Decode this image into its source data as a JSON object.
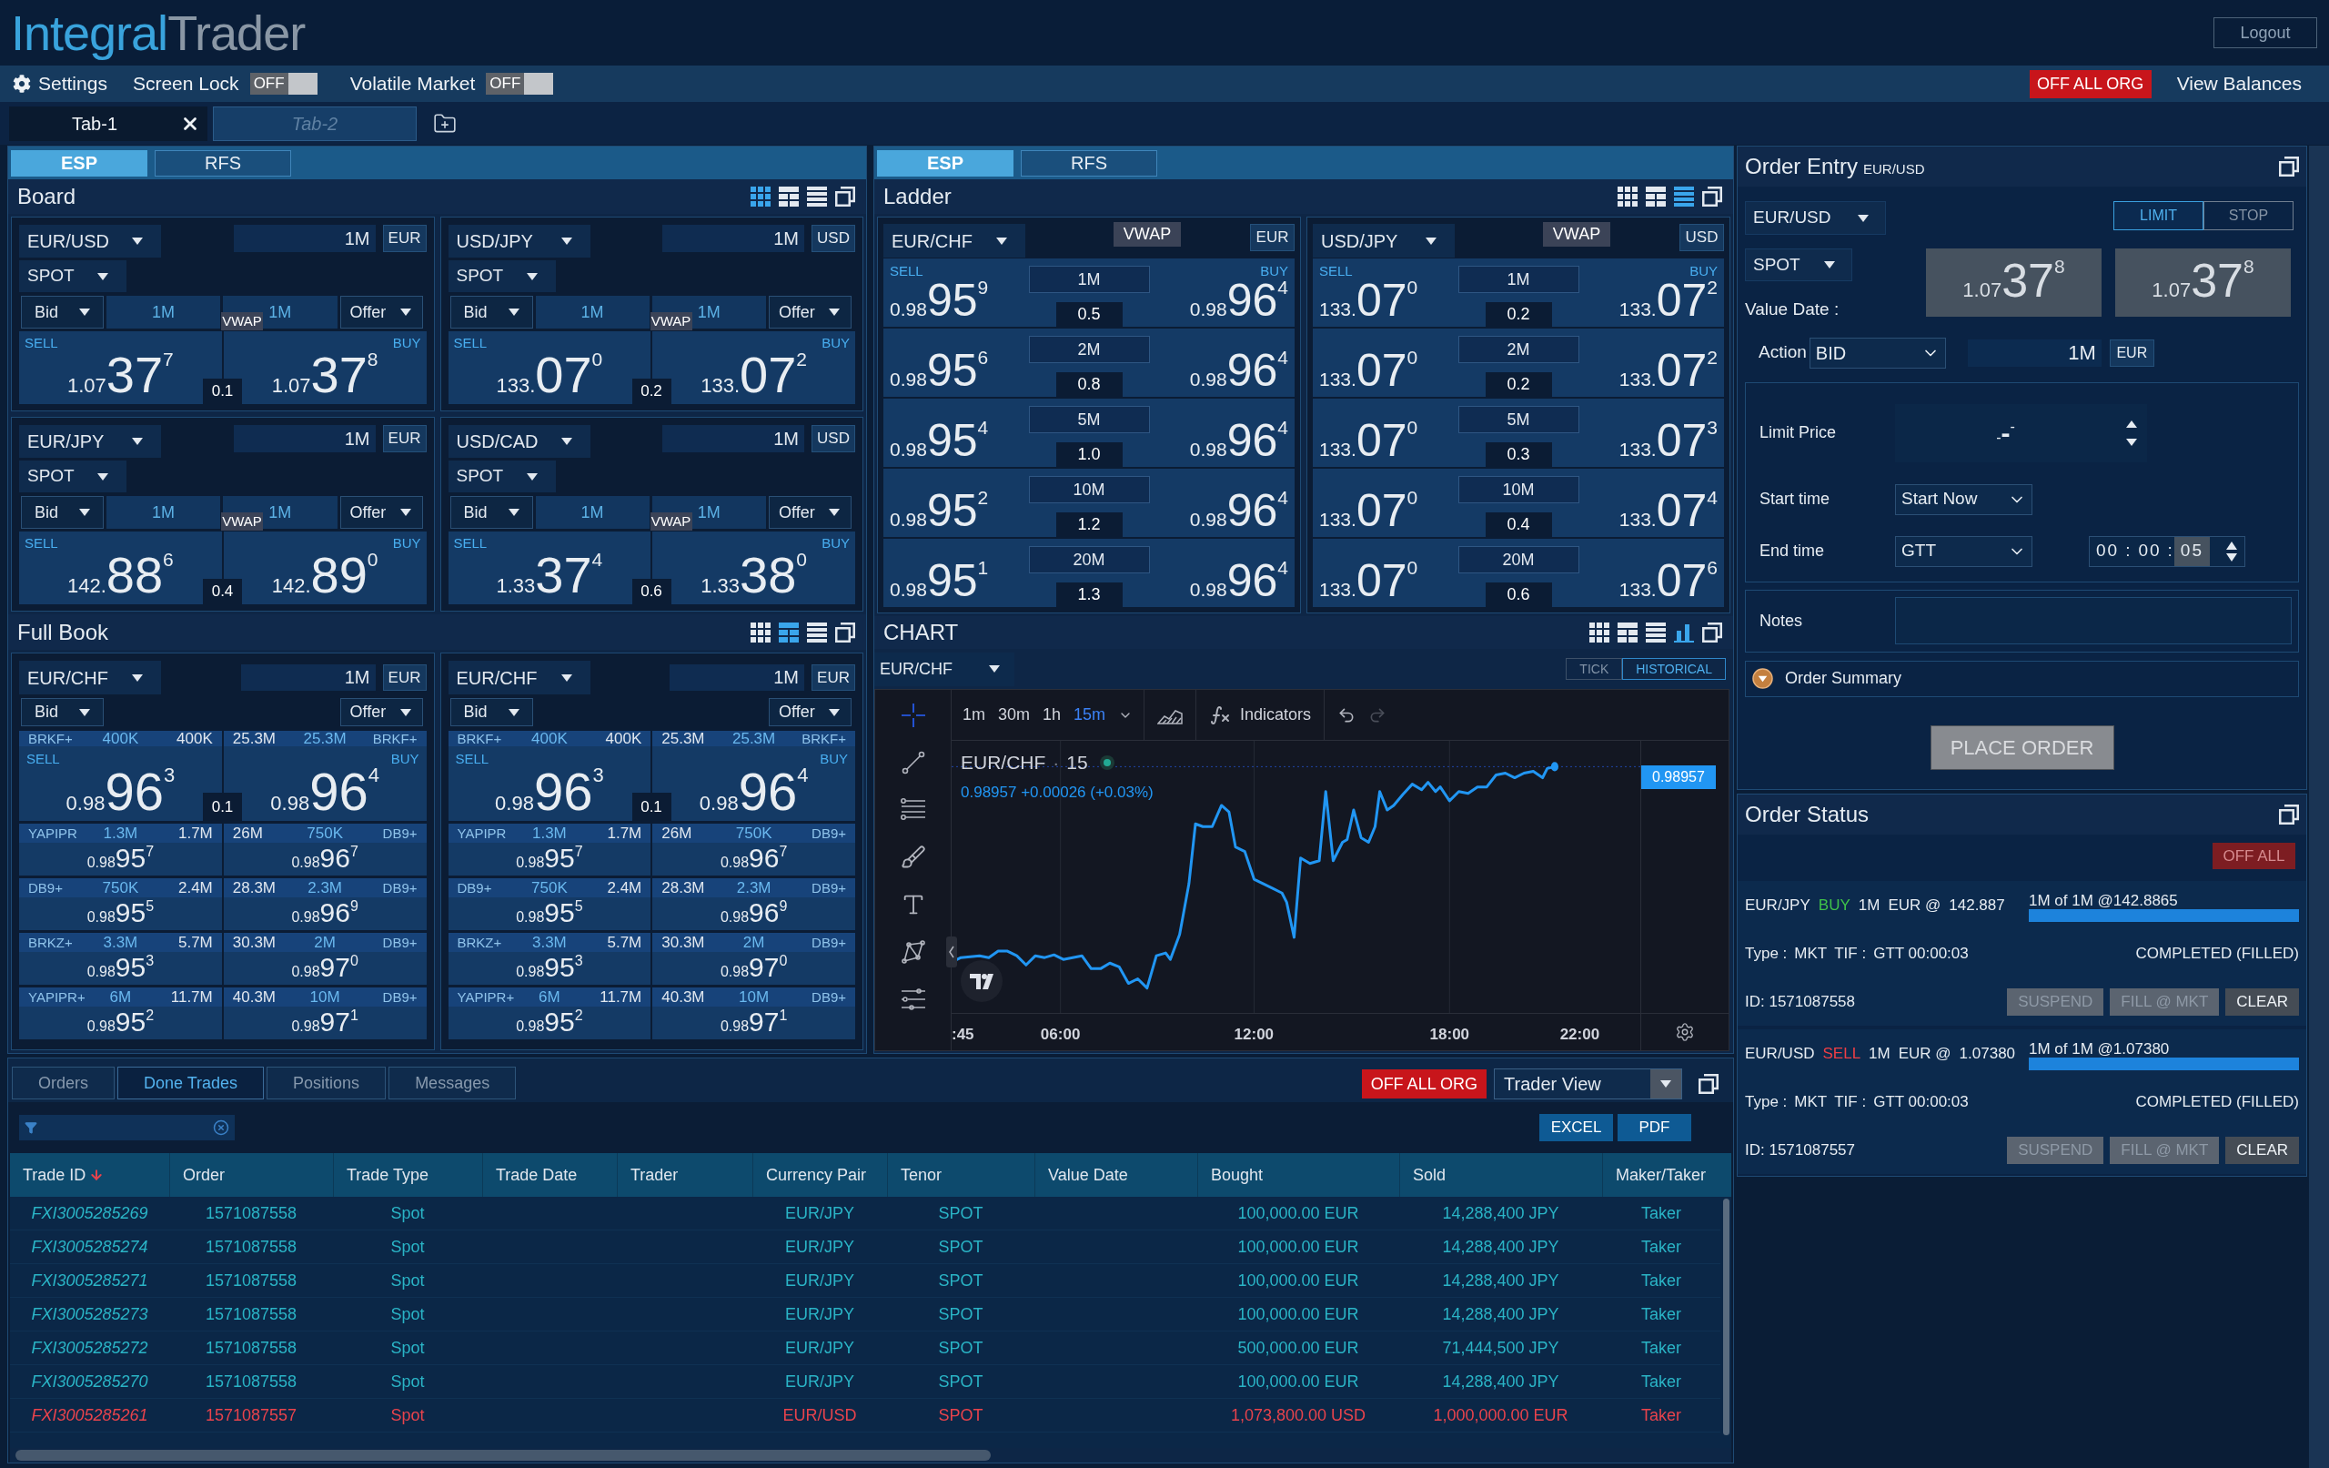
{
  "header": {
    "logo": {
      "first_part": "Integral",
      "second_part": "Trader"
    },
    "logout_button": "Logout"
  },
  "toolbar": {
    "settings": "Settings",
    "switches": [
      {
        "label": "Screen Lock",
        "state_text": "OFF",
        "on": false
      },
      {
        "label": "Volatile Market",
        "state_text": "OFF",
        "on": false
      }
    ],
    "off_all_org_button": "OFF ALL ORG",
    "view_balances": "View Balances"
  },
  "workspace_tabs": [
    {
      "label": "Tab-1",
      "selected": true
    },
    {
      "label": "Tab-2",
      "selected": false
    }
  ],
  "left_column": {
    "mode_tabs": [
      {
        "label": "ESP",
        "selected": true
      },
      {
        "label": "RFS",
        "selected": false
      }
    ],
    "board": {
      "title": "Board",
      "views": [
        {
          "kind": "grid",
          "selected": true
        },
        {
          "kind": "tiles",
          "selected": false
        },
        {
          "kind": "list",
          "selected": false
        }
      ],
      "tiles": [
        {
          "pair": "EUR/USD",
          "tenor": "SPOT",
          "amount": "1M",
          "currency": "EUR",
          "bid_select": "Bid",
          "bid_amount": "1M",
          "vwap": "VWAP",
          "offer_amount": "1M",
          "offer_select": "Offer",
          "sell_label": "SELL",
          "buy_label": "BUY",
          "sell_price": {
            "big": "1.07",
            "pips": "37",
            "frac": "7"
          },
          "buy_price": {
            "big": "1.07",
            "pips": "37",
            "frac": "8"
          },
          "spread": "0.1"
        },
        {
          "pair": "USD/JPY",
          "tenor": "SPOT",
          "amount": "1M",
          "currency": "USD",
          "bid_select": "Bid",
          "bid_amount": "1M",
          "vwap": "VWAP",
          "offer_amount": "1M",
          "offer_select": "Offer",
          "sell_label": "SELL",
          "buy_label": "BUY",
          "sell_price": {
            "big": "133.",
            "pips": "07",
            "frac": "0"
          },
          "buy_price": {
            "big": "133.",
            "pips": "07",
            "frac": "2"
          },
          "spread": "0.2"
        },
        {
          "pair": "EUR/JPY",
          "tenor": "SPOT",
          "amount": "1M",
          "currency": "EUR",
          "bid_select": "Bid",
          "bid_amount": "1M",
          "vwap": "VWAP",
          "offer_amount": "1M",
          "offer_select": "Offer",
          "sell_label": "SELL",
          "buy_label": "BUY",
          "sell_price": {
            "big": "142.",
            "pips": "88",
            "frac": "6"
          },
          "buy_price": {
            "big": "142.",
            "pips": "89",
            "frac": "0"
          },
          "spread": "0.4"
        },
        {
          "pair": "USD/CAD",
          "tenor": "SPOT",
          "amount": "1M",
          "currency": "USD",
          "bid_select": "Bid",
          "bid_amount": "1M",
          "vwap": "VWAP",
          "offer_amount": "1M",
          "offer_select": "Offer",
          "sell_label": "SELL",
          "buy_label": "BUY",
          "sell_price": {
            "big": "1.33",
            "pips": "37",
            "frac": "4"
          },
          "buy_price": {
            "big": "1.33",
            "pips": "38",
            "frac": "0"
          },
          "spread": "0.6"
        }
      ]
    },
    "full_book": {
      "title": "Full Book",
      "views": [
        {
          "kind": "grid",
          "selected": false
        },
        {
          "kind": "tiles",
          "selected": true
        },
        {
          "kind": "list",
          "selected": false
        }
      ],
      "books": [
        {
          "pair": "EUR/CHF",
          "amount": "1M",
          "currency": "EUR",
          "bid_select": "Bid",
          "offer_select": "Offer",
          "sell_label": "SELL",
          "buy_label": "BUY",
          "spread": "0.1",
          "levels": [
            {
              "bid": {
                "provider": "BRKF+",
                "size": "400K",
                "total": "400K",
                "price": {
                  "big": "0.98",
                  "pips": "96",
                  "frac": "3"
                }
              },
              "offer": {
                "total": "25.3M",
                "size": "25.3M",
                "provider": "BRKF+",
                "price": {
                  "big": "0.98",
                  "pips": "96",
                  "frac": "4"
                }
              }
            },
            {
              "bid": {
                "provider": "YAPIPR",
                "size": "1.3M",
                "total": "1.7M",
                "price": {
                  "big": "0.98",
                  "pips": "95",
                  "frac": "7"
                }
              },
              "offer": {
                "total": "26M",
                "size": "750K",
                "provider": "DB9+",
                "price": {
                  "big": "0.98",
                  "pips": "96",
                  "frac": "7"
                }
              }
            },
            {
              "bid": {
                "provider": "DB9+",
                "size": "750K",
                "total": "2.4M",
                "price": {
                  "big": "0.98",
                  "pips": "95",
                  "frac": "5"
                }
              },
              "offer": {
                "total": "28.3M",
                "size": "2.3M",
                "provider": "DB9+",
                "price": {
                  "big": "0.98",
                  "pips": "96",
                  "frac": "9"
                }
              }
            },
            {
              "bid": {
                "provider": "BRKZ+",
                "size": "3.3M",
                "total": "5.7M",
                "price": {
                  "big": "0.98",
                  "pips": "95",
                  "frac": "3"
                }
              },
              "offer": {
                "total": "30.3M",
                "size": "2M",
                "provider": "DB9+",
                "price": {
                  "big": "0.98",
                  "pips": "97",
                  "frac": "0"
                }
              }
            },
            {
              "bid": {
                "provider": "YAPIPR+",
                "size": "6M",
                "total": "11.7M",
                "price": {
                  "big": "0.98",
                  "pips": "95",
                  "frac": "2"
                }
              },
              "offer": {
                "total": "40.3M",
                "size": "10M",
                "provider": "DB9+",
                "price": {
                  "big": "0.98",
                  "pips": "97",
                  "frac": "1"
                }
              }
            }
          ]
        },
        {
          "pair": "EUR/CHF",
          "amount": "1M",
          "currency": "EUR",
          "bid_select": "Bid",
          "offer_select": "Offer",
          "sell_label": "SELL",
          "buy_label": "BUY",
          "spread": "0.1",
          "levels": [
            {
              "bid": {
                "provider": "BRKF+",
                "size": "400K",
                "total": "400K",
                "price": {
                  "big": "0.98",
                  "pips": "96",
                  "frac": "3"
                }
              },
              "offer": {
                "total": "25.3M",
                "size": "25.3M",
                "provider": "BRKF+",
                "price": {
                  "big": "0.98",
                  "pips": "96",
                  "frac": "4"
                }
              }
            },
            {
              "bid": {
                "provider": "YAPIPR",
                "size": "1.3M",
                "total": "1.7M",
                "price": {
                  "big": "0.98",
                  "pips": "95",
                  "frac": "7"
                }
              },
              "offer": {
                "total": "26M",
                "size": "750K",
                "provider": "DB9+",
                "price": {
                  "big": "0.98",
                  "pips": "96",
                  "frac": "7"
                }
              }
            },
            {
              "bid": {
                "provider": "DB9+",
                "size": "750K",
                "total": "2.4M",
                "price": {
                  "big": "0.98",
                  "pips": "95",
                  "frac": "5"
                }
              },
              "offer": {
                "total": "28.3M",
                "size": "2.3M",
                "provider": "DB9+",
                "price": {
                  "big": "0.98",
                  "pips": "96",
                  "frac": "9"
                }
              }
            },
            {
              "bid": {
                "provider": "BRKZ+",
                "size": "3.3M",
                "total": "5.7M",
                "price": {
                  "big": "0.98",
                  "pips": "95",
                  "frac": "3"
                }
              },
              "offer": {
                "total": "30.3M",
                "size": "2M",
                "provider": "DB9+",
                "price": {
                  "big": "0.98",
                  "pips": "97",
                  "frac": "0"
                }
              }
            },
            {
              "bid": {
                "provider": "YAPIPR+",
                "size": "6M",
                "total": "11.7M",
                "price": {
                  "big": "0.98",
                  "pips": "95",
                  "frac": "2"
                }
              },
              "offer": {
                "total": "40.3M",
                "size": "10M",
                "provider": "DB9+",
                "price": {
                  "big": "0.98",
                  "pips": "97",
                  "frac": "1"
                }
              }
            }
          ]
        }
      ]
    }
  },
  "middle_column": {
    "mode_tabs": [
      {
        "label": "ESP",
        "selected": true
      },
      {
        "label": "RFS",
        "selected": false
      }
    ],
    "ladder": {
      "title": "Ladder",
      "views": [
        {
          "kind": "grid",
          "selected": false
        },
        {
          "kind": "tiles",
          "selected": false
        },
        {
          "kind": "list",
          "selected": true
        }
      ],
      "books": [
        {
          "pair": "EUR/CHF",
          "vwap": "VWAP",
          "currency": "EUR",
          "sell_label": "SELL",
          "buy_label": "BUY",
          "rows": [
            {
              "size": "1M",
              "spread": "0.5",
              "sell_price": {
                "big": "0.98",
                "pips": "95",
                "frac": "9"
              },
              "buy_price": {
                "big": "0.98",
                "pips": "96",
                "frac": "4"
              }
            },
            {
              "size": "2M",
              "spread": "0.8",
              "sell_price": {
                "big": "0.98",
                "pips": "95",
                "frac": "6"
              },
              "buy_price": {
                "big": "0.98",
                "pips": "96",
                "frac": "4"
              }
            },
            {
              "size": "5M",
              "spread": "1.0",
              "sell_price": {
                "big": "0.98",
                "pips": "95",
                "frac": "4"
              },
              "buy_price": {
                "big": "0.98",
                "pips": "96",
                "frac": "4"
              }
            },
            {
              "size": "10M",
              "spread": "1.2",
              "sell_price": {
                "big": "0.98",
                "pips": "95",
                "frac": "2"
              },
              "buy_price": {
                "big": "0.98",
                "pips": "96",
                "frac": "4"
              }
            },
            {
              "size": "20M",
              "spread": "1.3",
              "sell_price": {
                "big": "0.98",
                "pips": "95",
                "frac": "1"
              },
              "buy_price": {
                "big": "0.98",
                "pips": "96",
                "frac": "4"
              }
            }
          ]
        },
        {
          "pair": "USD/JPY",
          "vwap": "VWAP",
          "currency": "USD",
          "sell_label": "SELL",
          "buy_label": "BUY",
          "rows": [
            {
              "size": "1M",
              "spread": "0.2",
              "sell_price": {
                "big": "133.",
                "pips": "07",
                "frac": "0"
              },
              "buy_price": {
                "big": "133.",
                "pips": "07",
                "frac": "2"
              }
            },
            {
              "size": "2M",
              "spread": "0.2",
              "sell_price": {
                "big": "133.",
                "pips": "07",
                "frac": "0"
              },
              "buy_price": {
                "big": "133.",
                "pips": "07",
                "frac": "2"
              }
            },
            {
              "size": "5M",
              "spread": "0.3",
              "sell_price": {
                "big": "133.",
                "pips": "07",
                "frac": "0"
              },
              "buy_price": {
                "big": "133.",
                "pips": "07",
                "frac": "3"
              }
            },
            {
              "size": "10M",
              "spread": "0.4",
              "sell_price": {
                "big": "133.",
                "pips": "07",
                "frac": "0"
              },
              "buy_price": {
                "big": "133.",
                "pips": "07",
                "frac": "4"
              }
            },
            {
              "size": "20M",
              "spread": "0.6",
              "sell_price": {
                "big": "133.",
                "pips": "07",
                "frac": "0"
              },
              "buy_price": {
                "big": "133.",
                "pips": "07",
                "frac": "6"
              }
            }
          ]
        }
      ]
    },
    "chart": {
      "title": "CHART",
      "views": [
        {
          "kind": "grid",
          "selected": false
        },
        {
          "kind": "tiles",
          "selected": false
        },
        {
          "kind": "list",
          "selected": false
        },
        {
          "kind": "bars",
          "selected": true
        }
      ],
      "pair": "EUR/CHF",
      "source_tabs": [
        {
          "label": "TICK",
          "selected": false
        },
        {
          "label": "HISTORICAL",
          "selected": true
        }
      ],
      "intervals": [
        {
          "label": "1m",
          "selected": false
        },
        {
          "label": "30m",
          "selected": false
        },
        {
          "label": "1h",
          "selected": false
        },
        {
          "label": "15m",
          "selected": true
        }
      ],
      "indicators_button": "Indicators",
      "legend": {
        "symbol": "EUR/CHF",
        "separator": "·",
        "interval": "15",
        "quote": "0.98957 +0.00026 (+0.03%)"
      },
      "last_price": "0.98957",
      "time_labels": [
        ":45",
        "06:00",
        "12:00",
        "18:00",
        "22:00"
      ]
    }
  },
  "right_column": {
    "order_entry": {
      "title": "Order Entry",
      "pair_caption": "EUR/USD",
      "pair": "EUR/USD",
      "order_types": [
        {
          "label": "LIMIT",
          "selected": true
        },
        {
          "label": "STOP",
          "selected": false
        }
      ],
      "tenor": "SPOT",
      "value_date_label": "Value Date :",
      "bid_price": {
        "big": "1.07",
        "pips": "37",
        "frac": "8"
      },
      "offer_price": {
        "big": "1.07",
        "pips": "37",
        "frac": "8"
      },
      "action_label": "Action",
      "action": "BID",
      "amount": "1M",
      "currency": "EUR",
      "limit_price_label": "Limit Price",
      "limit_price": {
        "big": "-",
        "pips": "-",
        "frac": "-"
      },
      "start_time_label": "Start time",
      "start_time": "Start Now",
      "end_time_label": "End time",
      "end_time": "GTT",
      "expiry": {
        "segments": [
          {
            "text": "00",
            "selected": false
          },
          {
            "text": "00",
            "selected": false
          },
          {
            "text": "05",
            "selected": true
          }
        ],
        "separators": [
          ":",
          ":"
        ]
      },
      "notes_label": "Notes",
      "summary_label": "Order Summary",
      "place_order": {
        "label": "PLACE ORDER",
        "disabled": true
      }
    },
    "order_status": {
      "title": "Order Status",
      "off_all": {
        "label": "OFF ALL",
        "disabled": true
      },
      "orders": [
        {
          "pair": "EUR/JPY",
          "side": {
            "text": "BUY",
            "kind": "buy"
          },
          "amount": "1M",
          "currency": "EUR @",
          "price": "142.887",
          "fill_text": "1M of 1M @142.8865",
          "level": 1,
          "type_label": "Type :",
          "type": "MKT",
          "tif_label": "TIF :",
          "tif": "GTT 00:00:03",
          "status": "COMPLETED (FILLED)",
          "id": "ID: 1571087558",
          "actions": [
            {
              "label": "SUSPEND",
              "disabled": true
            },
            {
              "label": "FILL @ MKT",
              "disabled": true
            },
            {
              "label": "CLEAR",
              "disabled": false
            }
          ]
        },
        {
          "pair": "EUR/USD",
          "side": {
            "text": "SELL",
            "kind": "sell"
          },
          "amount": "1M",
          "currency": "EUR @",
          "price": "1.07380",
          "fill_text": "1M of 1M @1.07380",
          "level": 1,
          "type_label": "Type :",
          "type": "MKT",
          "tif_label": "TIF :",
          "tif": "GTT 00:00:03",
          "status": "COMPLETED (FILLED)",
          "id": "ID: 1571087557",
          "actions": [
            {
              "label": "SUSPEND",
              "disabled": true
            },
            {
              "label": "FILL @ MKT",
              "disabled": true
            },
            {
              "label": "CLEAR",
              "disabled": false
            }
          ]
        }
      ]
    }
  },
  "blotter": {
    "tabs": [
      {
        "label": "Orders",
        "selected": false
      },
      {
        "label": "Done Trades",
        "selected": true
      },
      {
        "label": "Positions",
        "selected": false
      },
      {
        "label": "Messages",
        "selected": false
      }
    ],
    "off_all_org_button": "OFF ALL ORG",
    "view_select": "Trader View",
    "export_buttons": [
      "EXCEL",
      "PDF"
    ],
    "table": {
      "columns": [
        {
          "label": "Trade ID",
          "sorted": true
        },
        {
          "label": "Order",
          "sorted": false
        },
        {
          "label": "Trade Type",
          "sorted": false
        },
        {
          "label": "Trade Date",
          "sorted": false
        },
        {
          "label": "Trader",
          "sorted": false
        },
        {
          "label": "Currency Pair",
          "sorted": false
        },
        {
          "label": "Tenor",
          "sorted": false
        },
        {
          "label": "Value Date",
          "sorted": false
        },
        {
          "label": "Bought",
          "sorted": false
        },
        {
          "label": "Sold",
          "sorted": false
        },
        {
          "label": "Maker/Taker",
          "sorted": false
        }
      ],
      "rows": [
        {
          "color": "#2ab4c6",
          "trade_id": "FXI3005285269",
          "order": "1571087558",
          "trade_type": "Spot",
          "currency_pair": "EUR/JPY",
          "tenor": "SPOT",
          "bought": "100,000.00 EUR",
          "sold": "14,288,400 JPY",
          "maker_taker": "Taker"
        },
        {
          "color": "#2ab4c6",
          "trade_id": "FXI3005285274",
          "order": "1571087558",
          "trade_type": "Spot",
          "currency_pair": "EUR/JPY",
          "tenor": "SPOT",
          "bought": "100,000.00 EUR",
          "sold": "14,288,400 JPY",
          "maker_taker": "Taker"
        },
        {
          "color": "#2ab4c6",
          "trade_id": "FXI3005285271",
          "order": "1571087558",
          "trade_type": "Spot",
          "currency_pair": "EUR/JPY",
          "tenor": "SPOT",
          "bought": "100,000.00 EUR",
          "sold": "14,288,400 JPY",
          "maker_taker": "Taker"
        },
        {
          "color": "#2ab4c6",
          "trade_id": "FXI3005285273",
          "order": "1571087558",
          "trade_type": "Spot",
          "currency_pair": "EUR/JPY",
          "tenor": "SPOT",
          "bought": "100,000.00 EUR",
          "sold": "14,288,400 JPY",
          "maker_taker": "Taker"
        },
        {
          "color": "#2ab4c6",
          "trade_id": "FXI3005285272",
          "order": "1571087558",
          "trade_type": "Spot",
          "currency_pair": "EUR/JPY",
          "tenor": "SPOT",
          "bought": "500,000.00 EUR",
          "sold": "71,444,500 JPY",
          "maker_taker": "Taker"
        },
        {
          "color": "#2ab4c6",
          "trade_id": "FXI3005285270",
          "order": "1571087558",
          "trade_type": "Spot",
          "currency_pair": "EUR/JPY",
          "tenor": "SPOT",
          "bought": "100,000.00 EUR",
          "sold": "14,288,400 JPY",
          "maker_taker": "Taker"
        },
        {
          "color": "#e8434c",
          "trade_id": "FXI3005285261",
          "order": "1571087557",
          "trade_type": "Spot",
          "currency_pair": "EUR/USD",
          "tenor": "SPOT",
          "bought": "1,073,800.00 USD",
          "sold": "1,000,000.00 EUR",
          "maker_taker": "Taker"
        }
      ]
    }
  }
}
